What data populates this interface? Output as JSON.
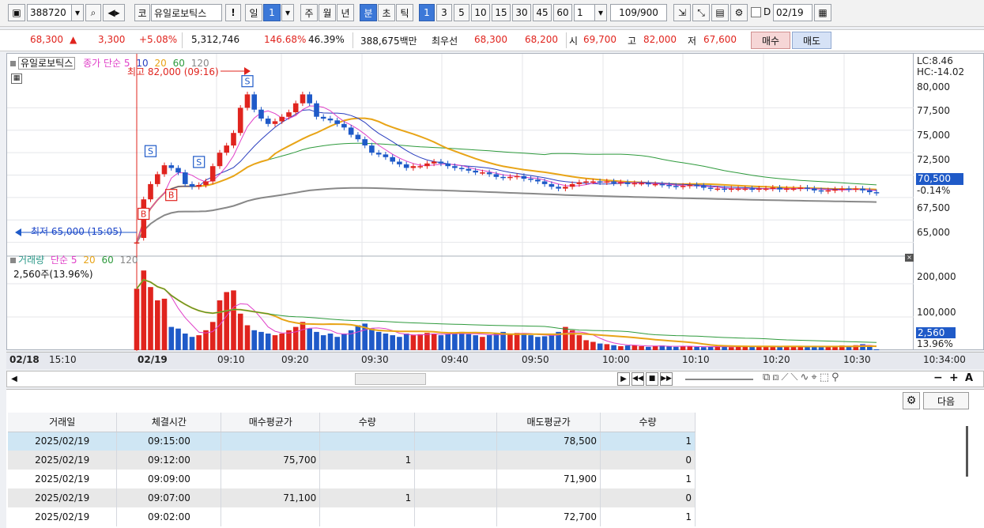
{
  "toolbar": {
    "stock_code": "388720",
    "market_tag": "코",
    "stock_name": "유일로보틱스",
    "alert_mark": "!",
    "period_buttons": [
      "일",
      "1",
      "주",
      "월",
      "년",
      "분",
      "초",
      "틱",
      "1",
      "3",
      "5",
      "10",
      "15",
      "30",
      "45",
      "60"
    ],
    "interval_value": "1",
    "count_display": "109/900",
    "date_checkbox_label": "D",
    "date_value": "02/19"
  },
  "info": {
    "price": "68,300",
    "change": "3,300",
    "change_pct": "+5.08%",
    "volume": "5,312,746",
    "vol_ratio": "146.68%",
    "turnover": "46.39%",
    "trade_value": "388,675백만",
    "best_quote_label": "최우선",
    "best_ask": "68,300",
    "best_bid": "68,200",
    "open_label": "시",
    "open": "69,700",
    "high_label": "고",
    "high": "82,000",
    "low_label": "저",
    "low": "67,600",
    "buy_label": "매수",
    "sell_label": "매도"
  },
  "chart_legend": {
    "stock_name": "유일로보틱스",
    "price_series_label": "종가",
    "ma_label": "단순",
    "ma_periods": [
      "5",
      "10",
      "20",
      "60",
      "120"
    ],
    "max_annotation": "최고 82,000 (09:16)",
    "min_annotation": "최저 65,000 (15:05)",
    "lc_label": "LC:8.46",
    "hc_label": "HC:-14.02",
    "current_price_tag": "70,500",
    "current_change_tag": "-0.14%"
  },
  "volume_legend": {
    "label": "거래량",
    "ma_label": "단순",
    "ma_periods": [
      "5",
      "20",
      "60",
      "120"
    ],
    "current_volume": "2,560주(13.96%)",
    "current_tag": "2,560",
    "current_pct_tag": "13.96%"
  },
  "colors": {
    "up": "#e0241e",
    "down": "#1f5ac8",
    "ma5": "#e040c8",
    "ma10": "#2b3fbf",
    "ma20": "#e8a417",
    "ma60": "#2e9a3c",
    "ma120": "#888888"
  },
  "chart_data": {
    "type": "candlestick",
    "price_axis_ticks": [
      "80,000",
      "77,500",
      "75,000",
      "72,500",
      "70,000",
      "67,500",
      "65,000"
    ],
    "volume_axis_ticks": [
      "200,000",
      "100,000"
    ],
    "x_ticks": [
      "02/18",
      "15:10",
      "02/19",
      "09:10",
      "09:20",
      "09:30",
      "09:40",
      "09:50",
      "10:00",
      "10:10",
      "10:20",
      "10:30",
      "10:34:00"
    ],
    "ylim": [
      64000,
      85500
    ],
    "price_close": [
      65000,
      69800,
      71500,
      72600,
      73600,
      73300,
      72800,
      71500,
      71200,
      71400,
      71800,
      73500,
      75000,
      75800,
      77200,
      80000,
      81500,
      79800,
      78800,
      78200,
      78500,
      79000,
      79500,
      80500,
      81500,
      80500,
      79000,
      78800,
      78600,
      78200,
      77800,
      77000,
      76500,
      75800,
      75000,
      74800,
      74500,
      74000,
      73700,
      73300,
      73500,
      73500,
      73800,
      74000,
      73800,
      73500,
      73300,
      73200,
      73000,
      72800,
      72800,
      72600,
      72300,
      72200,
      72300,
      72400,
      72100,
      72000,
      71800,
      71500,
      71200,
      71000,
      71200,
      71500,
      71700,
      71800,
      71800,
      71700,
      71800,
      71600,
      71700,
      71500,
      71600,
      71600,
      71500,
      71500,
      71400,
      71300,
      71200,
      71300,
      71400,
      71300,
      71100,
      71000,
      71000,
      70900,
      71000,
      71000,
      71000,
      70900,
      71000,
      71000,
      71100,
      70900,
      71000,
      71000,
      71100,
      71000,
      70800,
      70700,
      70800,
      70900,
      71000,
      70900,
      71000,
      70800,
      70600,
      70500
    ],
    "price_open": [
      65000,
      65500,
      69800,
      71500,
      72600,
      73600,
      73300,
      72800,
      71500,
      71200,
      71400,
      71800,
      73500,
      75000,
      75800,
      77200,
      80000,
      81500,
      79800,
      78800,
      78200,
      78500,
      79000,
      79500,
      80500,
      81500,
      80500,
      79000,
      78800,
      78600,
      78200,
      77800,
      77000,
      76500,
      75800,
      75000,
      74800,
      74500,
      74000,
      73700,
      73300,
      73500,
      73500,
      73800,
      74000,
      73800,
      73500,
      73300,
      73200,
      73000,
      72800,
      72800,
      72600,
      72300,
      72200,
      72300,
      72400,
      72100,
      72000,
      71800,
      71500,
      71200,
      71000,
      71200,
      71500,
      71700,
      71800,
      71800,
      71700,
      71800,
      71600,
      71700,
      71500,
      71600,
      71600,
      71500,
      71500,
      71400,
      71300,
      71200,
      71300,
      71400,
      71300,
      71100,
      71000,
      71000,
      70900,
      71000,
      71000,
      71000,
      70900,
      71000,
      71000,
      71100,
      70900,
      71000,
      71000,
      71100,
      71000,
      70800,
      70700,
      70800,
      70900,
      71000,
      70900,
      71000,
      70800,
      70600
    ],
    "volume": [
      185000,
      240000,
      190000,
      150000,
      155000,
      70000,
      65000,
      50000,
      40000,
      45000,
      60000,
      85000,
      150000,
      175000,
      180000,
      110000,
      75000,
      60000,
      55000,
      50000,
      45000,
      50000,
      60000,
      70000,
      85000,
      65000,
      55000,
      45000,
      50000,
      40000,
      50000,
      60000,
      75000,
      80000,
      65000,
      55000,
      50000,
      45000,
      40000,
      50000,
      45000,
      48000,
      52000,
      50000,
      45000,
      48000,
      52000,
      55000,
      48000,
      45000,
      40000,
      45000,
      50000,
      55000,
      48000,
      52000,
      50000,
      45000,
      40000,
      42000,
      45000,
      55000,
      70000,
      60000,
      45000,
      30000,
      25000,
      20000,
      18000,
      15000,
      12000,
      14000,
      15000,
      12000,
      10000,
      12000,
      14000,
      12000,
      10000,
      11000,
      12000,
      10000,
      9000,
      10000,
      12000,
      11000,
      9000,
      10000,
      11000,
      12000,
      13000,
      12000,
      11000,
      10000,
      12000,
      13000,
      12000,
      11000,
      10000,
      9000,
      10000,
      12000,
      14000,
      12000,
      15000,
      18000,
      14000,
      2560
    ]
  }
}
